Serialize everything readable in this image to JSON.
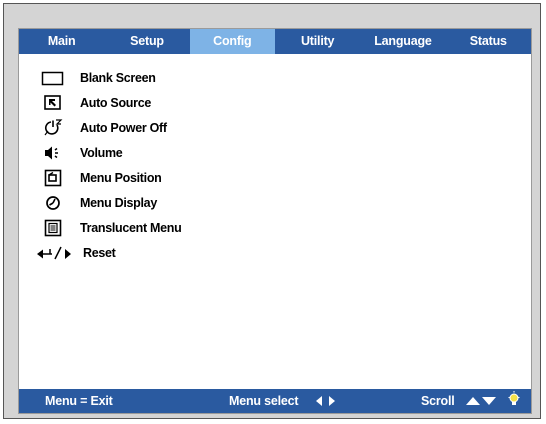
{
  "tabs": [
    {
      "label": "Main",
      "active": false
    },
    {
      "label": "Setup",
      "active": false
    },
    {
      "label": "Config",
      "active": true
    },
    {
      "label": "Utility",
      "active": false
    },
    {
      "label": "Language",
      "active": false
    },
    {
      "label": "Status",
      "active": false
    }
  ],
  "menu": {
    "items": [
      {
        "label": "Blank Screen",
        "icon": "blank-screen-icon"
      },
      {
        "label": "Auto Source",
        "icon": "auto-source-icon"
      },
      {
        "label": "Auto Power Off",
        "icon": "auto-power-off-icon"
      },
      {
        "label": "Volume",
        "icon": "volume-icon"
      },
      {
        "label": "Menu Position",
        "icon": "menu-position-icon"
      },
      {
        "label": "Menu Display",
        "icon": "menu-display-icon"
      },
      {
        "label": "Translucent Menu",
        "icon": "translucent-menu-icon"
      },
      {
        "label": "Reset",
        "icon": "reset-icon"
      }
    ]
  },
  "statusbar": {
    "exit_hint": "Menu = Exit",
    "select_hint": "Menu select",
    "scroll_hint": "Scroll"
  },
  "colors": {
    "bar": "#2a5aa0",
    "active_tab": "#7eb3e6",
    "text_on_bar": "#ffffff"
  }
}
